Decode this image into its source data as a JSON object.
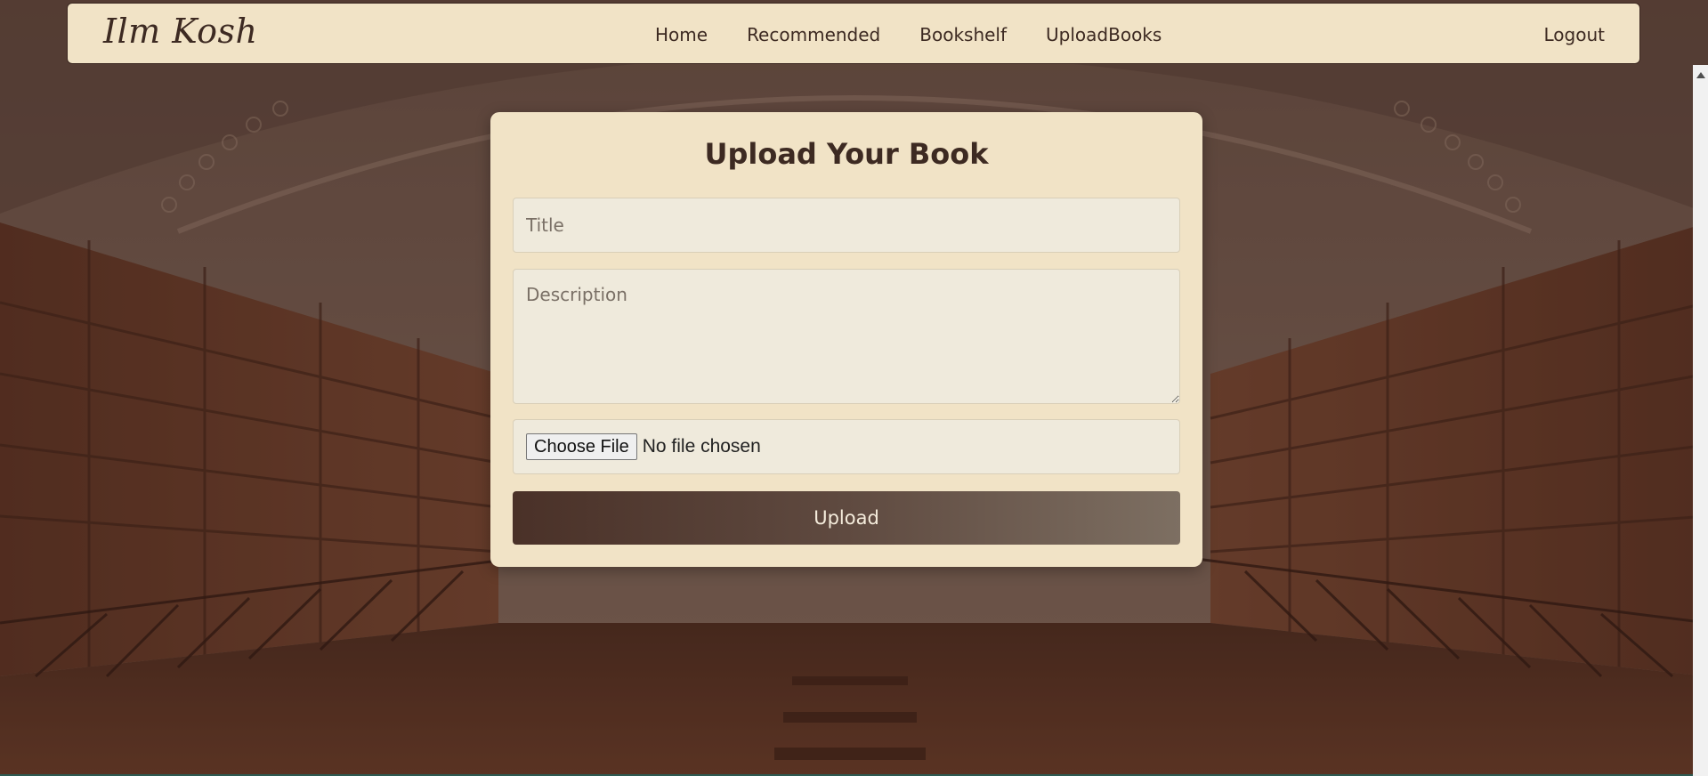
{
  "nav": {
    "brand": "Ilm Kosh",
    "links": [
      "Home",
      "Recommended",
      "Bookshelf",
      "UploadBooks"
    ],
    "logout": "Logout"
  },
  "upload_form": {
    "heading": "Upload Your Book",
    "title_placeholder": "Title",
    "description_placeholder": "Description",
    "choose_file_label": "Choose File",
    "no_file_text": "No file chosen",
    "submit_label": "Upload"
  },
  "colors": {
    "panel": "#f1e3c6",
    "text": "#3d2a22",
    "button_gradient_start": "#4a3128",
    "button_gradient_end": "#7d6f62"
  }
}
